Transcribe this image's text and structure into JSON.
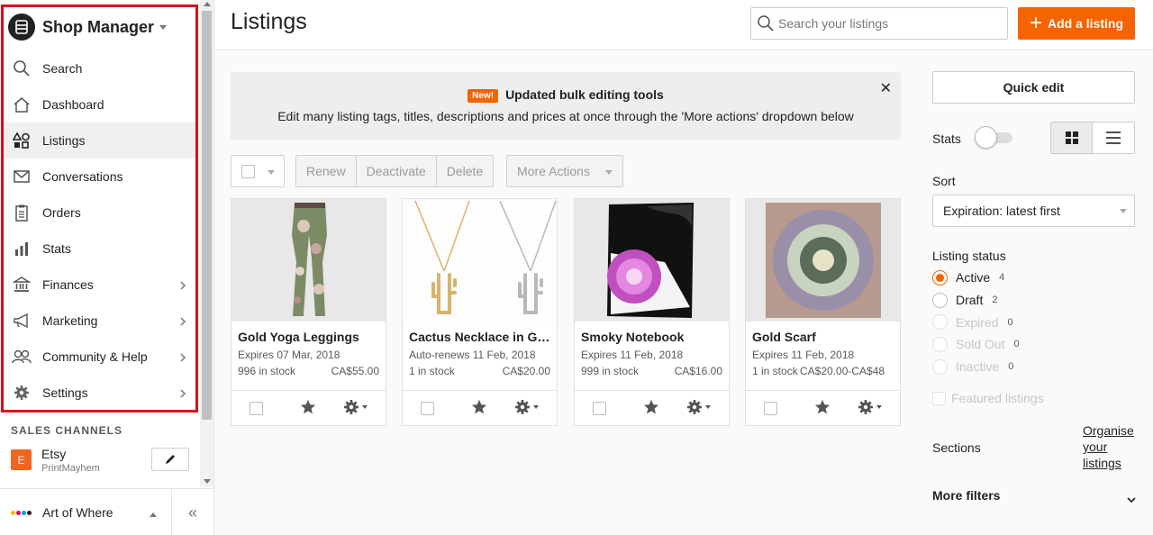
{
  "sidebar": {
    "title": "Shop Manager",
    "items": [
      {
        "label": "Search",
        "icon": "search-icon"
      },
      {
        "label": "Dashboard",
        "icon": "home-icon"
      },
      {
        "label": "Listings",
        "icon": "shapes-icon",
        "active": true
      },
      {
        "label": "Conversations",
        "icon": "envelope-icon"
      },
      {
        "label": "Orders",
        "icon": "clipboard-icon"
      },
      {
        "label": "Stats",
        "icon": "bar-chart-icon"
      },
      {
        "label": "Finances",
        "icon": "bank-icon",
        "has_submenu": true
      },
      {
        "label": "Marketing",
        "icon": "megaphone-icon",
        "has_submenu": true
      },
      {
        "label": "Community & Help",
        "icon": "people-icon",
        "has_submenu": true
      },
      {
        "label": "Settings",
        "icon": "gear-icon",
        "has_submenu": true
      }
    ],
    "sales_channels_title": "SALES CHANNELS",
    "channel": {
      "badge": "E",
      "name": "Etsy",
      "shop": "PrintMayhem"
    },
    "footer_label": "Art of Where"
  },
  "header": {
    "title": "Listings",
    "search_placeholder": "Search your listings",
    "add_label": "Add a listing"
  },
  "banner": {
    "badge": "New!",
    "heading": "Updated bulk editing tools",
    "text": "Edit many listing tags, titles, descriptions and prices at once through the 'More actions' dropdown below"
  },
  "toolbar": {
    "renew": "Renew",
    "deactivate": "Deactivate",
    "delete": "Delete",
    "more_actions": "More Actions"
  },
  "listings": [
    {
      "title": "Gold Yoga Leggings",
      "sub": "Expires 07 Mar, 2018",
      "stock": "996 in stock",
      "price": "CA$55.00"
    },
    {
      "title": "Cactus Necklace in Go...",
      "sub": "Auto-renews 11 Feb, 2018",
      "stock": "1 in stock",
      "price": "CA$20.00"
    },
    {
      "title": "Smoky Notebook",
      "sub": "Expires 11 Feb, 2018",
      "stock": "999 in stock",
      "price": "CA$16.00"
    },
    {
      "title": "Gold Scarf",
      "sub": "Expires 11 Feb, 2018",
      "stock": "1 in stock",
      "price": "CA$20.00-CA$48"
    }
  ],
  "panel": {
    "quick_edit": "Quick edit",
    "stats_label": "Stats",
    "stats_on": false,
    "sort_label": "Sort",
    "sort_value": "Expiration: latest first",
    "status_label": "Listing status",
    "statuses": [
      {
        "label": "Active",
        "count": "4"
      },
      {
        "label": "Draft",
        "count": "2"
      },
      {
        "label": "Expired",
        "count": "0"
      },
      {
        "label": "Sold Out",
        "count": "0"
      },
      {
        "label": "Inactive",
        "count": "0"
      }
    ],
    "featured_label": "Featured listings",
    "sections_label": "Sections",
    "organise_link": "Organise your listings",
    "more_filters": "More filters"
  },
  "colors": {
    "accent": "#f56400",
    "highlight_border": "#e0001b"
  }
}
